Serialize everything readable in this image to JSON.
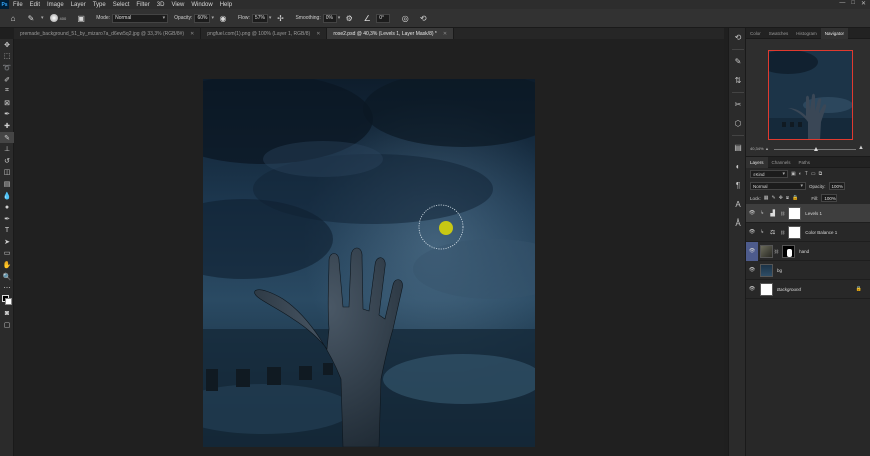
{
  "menu": {
    "logo": "Ps",
    "items": [
      "File",
      "Edit",
      "Image",
      "Layer",
      "Type",
      "Select",
      "Filter",
      "3D",
      "View",
      "Window",
      "Help"
    ],
    "window_controls": [
      "—",
      "□",
      "✕"
    ]
  },
  "options": {
    "brush_size": "400",
    "mode_label": "Mode:",
    "mode_value": "Normal",
    "opacity_label": "Opacity:",
    "opacity_value": "60%",
    "flow_label": "Flow:",
    "flow_value": "57%",
    "smoothing_label": "Smoothing:",
    "smoothing_value": "0%",
    "angle_value": "0°"
  },
  "tabs": [
    {
      "label": "premade_background_51_by_mizaro7a_d6ew5q2.jpg @ 33,3% (RGB/8#)",
      "active": false
    },
    {
      "label": "pngfuel.com(1).png @ 100% (Layer 1, RGB/8)",
      "active": false
    },
    {
      "label": "rose2.psd @ 40,3% (Levels 1, Layer Mask/8) *",
      "active": true
    }
  ],
  "navigator": {
    "tabs": [
      "Color",
      "Swatches",
      "Histogram",
      "Navigator"
    ],
    "active_tab": "Navigator",
    "zoom": "40,34%"
  },
  "layers_panel": {
    "tabs": [
      "Layers",
      "Channels",
      "Paths"
    ],
    "active_tab": "Layers",
    "filter_kind": "Kind",
    "blend_mode": "Normal",
    "opacity_label": "Opacity:",
    "opacity_value": "100%",
    "lock_label": "Lock:",
    "fill_label": "Fill:",
    "fill_value": "100%",
    "layers": [
      {
        "name": "Levels 1",
        "type": "adjustment",
        "visible": true,
        "selected": true,
        "clipped": true
      },
      {
        "name": "Color Balance 1",
        "type": "adjustment",
        "visible": true,
        "selected": false,
        "clipped": true
      },
      {
        "name": "hand",
        "type": "pixel",
        "visible": true,
        "selected": false,
        "clipped": false
      },
      {
        "name": "bg",
        "type": "pixel",
        "visible": true,
        "selected": false,
        "clipped": false
      },
      {
        "name": "Background",
        "type": "background",
        "visible": true,
        "selected": false,
        "locked": true
      }
    ]
  },
  "colors": {
    "accent_selection": "#4d5b8c",
    "brush_dot": "#c8c814",
    "navigator_frame": "#e03a2f"
  }
}
